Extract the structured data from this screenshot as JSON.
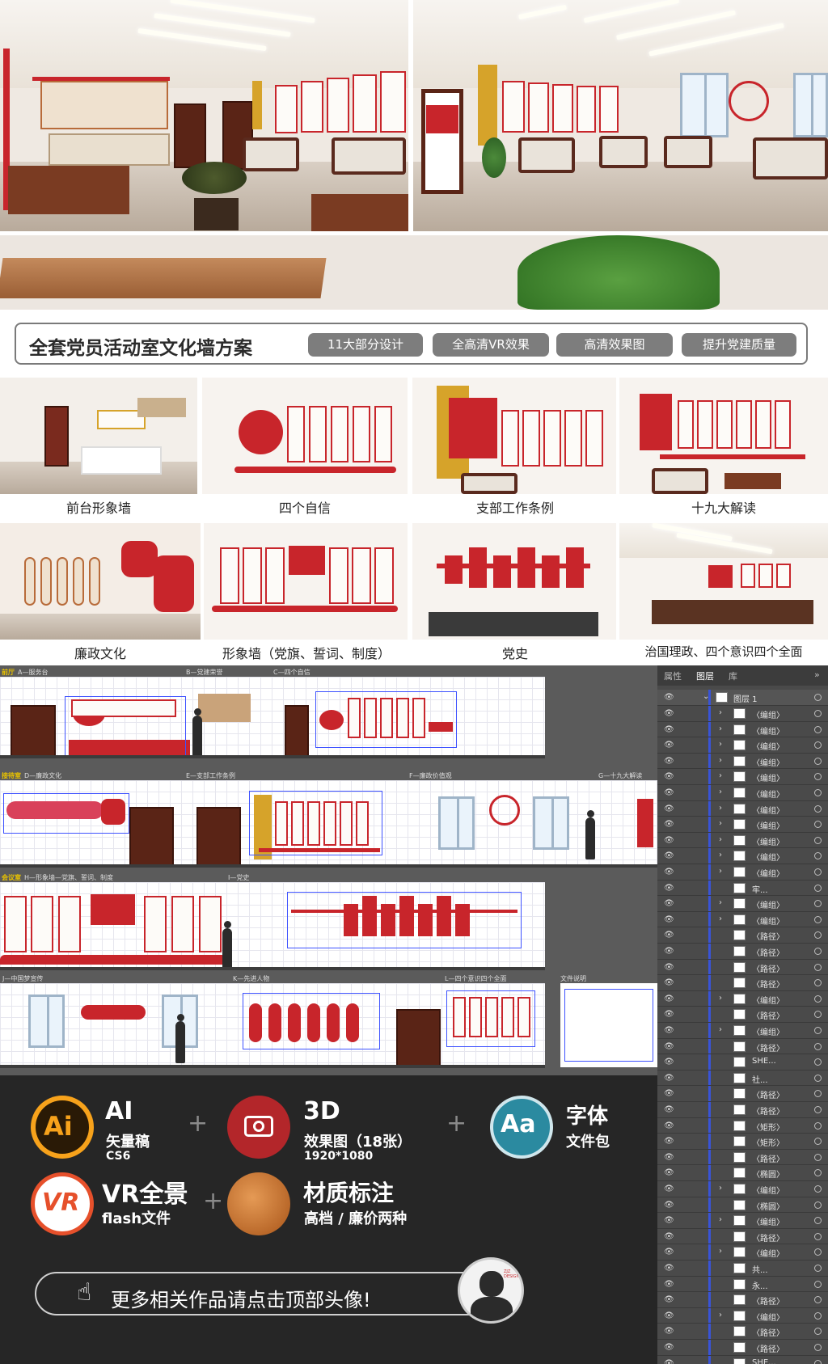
{
  "banner": {
    "title": "全套党员活动室文化墙方案",
    "tags": [
      "11大部分设计",
      "全高清VR效果",
      "高清效果图",
      "提升党建质量"
    ]
  },
  "thumbnails": [
    {
      "caption": "前台形象墙"
    },
    {
      "caption": "四个自信"
    },
    {
      "caption": "支部工作条例"
    },
    {
      "caption": "十九大解读"
    },
    {
      "caption": "廉政文化"
    },
    {
      "caption": "形象墙（党旗、誓词、制度）"
    },
    {
      "caption": "党史"
    },
    {
      "caption": "治国理政、四个意识四个全面"
    }
  ],
  "drawing": {
    "rows": [
      {
        "labels": [
          "前厅",
          "A—服务台",
          "B—党建荣誉",
          "C—四个自信"
        ]
      },
      {
        "labels": [
          "接待室",
          "D—廉政文化",
          "E—支部工作条例",
          "F—廉政价值观",
          "G—十九大解读"
        ]
      },
      {
        "labels": [
          "会议室",
          "H—形象墙—党旗、誓词、制度",
          "I—党史"
        ]
      },
      {
        "labels": [
          "J—中国梦宣传",
          "K—先进人物",
          "L—四个意识四个全面",
          "文件说明"
        ]
      }
    ]
  },
  "layers_panel": {
    "tabs": [
      "属性",
      "图层",
      "库"
    ],
    "expand_icon": "»",
    "root": "图层 1",
    "items": [
      {
        "name": "〈编组〉",
        "expand": true
      },
      {
        "name": "〈编组〉",
        "expand": true
      },
      {
        "name": "〈编组〉",
        "expand": true
      },
      {
        "name": "〈编组〉",
        "expand": true
      },
      {
        "name": "〈编组〉",
        "expand": true
      },
      {
        "name": "〈编组〉",
        "expand": true
      },
      {
        "name": "〈编组〉",
        "expand": true
      },
      {
        "name": "〈编组〉",
        "expand": true
      },
      {
        "name": "〈编组〉",
        "expand": true
      },
      {
        "name": "〈编组〉",
        "expand": true
      },
      {
        "name": "〈编组〉",
        "expand": true
      },
      {
        "name": "牢...",
        "expand": false
      },
      {
        "name": "〈编组〉",
        "expand": true
      },
      {
        "name": "〈编组〉",
        "expand": true
      },
      {
        "name": "〈路径〉",
        "expand": false
      },
      {
        "name": "〈路径〉",
        "expand": false
      },
      {
        "name": "〈路径〉",
        "expand": false
      },
      {
        "name": "〈路径〉",
        "expand": false
      },
      {
        "name": "〈编组〉",
        "expand": true
      },
      {
        "name": "〈路径〉",
        "expand": false
      },
      {
        "name": "〈编组〉",
        "expand": true
      },
      {
        "name": "〈路径〉",
        "expand": false
      },
      {
        "name": "SHE...",
        "expand": false
      },
      {
        "name": "社...",
        "expand": false
      },
      {
        "name": "〈路径〉",
        "expand": false
      },
      {
        "name": "〈路径〉",
        "expand": false
      },
      {
        "name": "〈矩形〉",
        "expand": false
      },
      {
        "name": "〈矩形〉",
        "expand": false
      },
      {
        "name": "〈路径〉",
        "expand": false
      },
      {
        "name": "〈椭圆〉",
        "expand": false
      },
      {
        "name": "〈编组〉",
        "expand": true
      },
      {
        "name": "〈椭圆〉",
        "expand": false
      },
      {
        "name": "〈编组〉",
        "expand": true
      },
      {
        "name": "〈路径〉",
        "expand": false
      },
      {
        "name": "〈编组〉",
        "expand": true
      },
      {
        "name": "共...",
        "expand": false
      },
      {
        "name": "永...",
        "expand": false
      },
      {
        "name": "〈路径〉",
        "expand": false
      },
      {
        "name": "〈编组〉",
        "expand": true
      },
      {
        "name": "〈路径〉",
        "expand": false
      },
      {
        "name": "〈路径〉",
        "expand": false
      },
      {
        "name": "SHE...",
        "expand": false
      }
    ]
  },
  "features": {
    "ai": {
      "icon_text": "Ai",
      "title": "AI",
      "line1": "矢量稿",
      "line2": "CS6"
    },
    "render": {
      "title": "3D",
      "line1": "效果图（18张）",
      "line2": "1920*1080"
    },
    "font": {
      "icon_text": "Aa",
      "title": "字体",
      "line1": "文件包"
    },
    "vr": {
      "icon_text": "VR",
      "title": "VR全景",
      "line1": "flash文件"
    },
    "material": {
      "title": "材质标注",
      "line1": "高档 / 廉价两种"
    },
    "plus": "+"
  },
  "cta": {
    "text": "更多相关作品请点击顶部头像!",
    "avatar_caption": "ZJZ DESIGN"
  },
  "colors": {
    "party_red": "#c8252b",
    "dark_bg": "#262626",
    "panel_bg": "#4a4a4a",
    "tag_gray": "#7d7d7d",
    "selection_blue": "#3e52ff",
    "ai_orange": "#f7a21b"
  }
}
